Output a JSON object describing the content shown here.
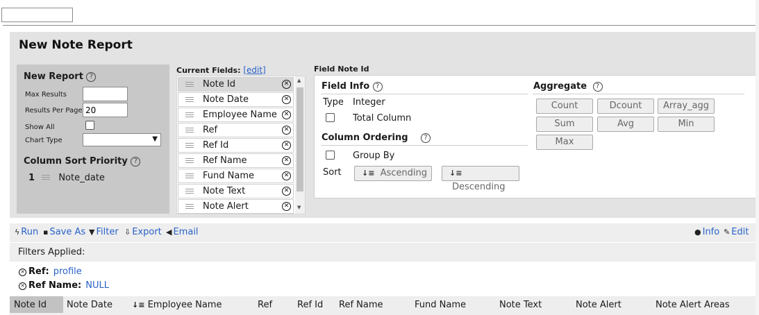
{
  "page": {
    "report_title": "New Note Report"
  },
  "new_report": {
    "heading": "New Report",
    "help": "?",
    "max_results_label": "Max Results",
    "max_results_value": "",
    "results_per_page_label": "Results Per Page",
    "results_per_page_value": "20",
    "show_all_label": "Show All",
    "chart_type_label": "Chart Type",
    "chart_type_value": ""
  },
  "column_sort": {
    "heading": "Column Sort Priority",
    "items": [
      {
        "index": "1",
        "label": "Note_date"
      }
    ]
  },
  "current_fields": {
    "label": "Current Fields:",
    "edit_link": "[edit]",
    "fields": [
      "Note Id",
      "Note Date",
      "Employee Name",
      "Ref",
      "Ref Id",
      "Ref Name",
      "Fund Name",
      "Note Text",
      "Note Alert"
    ],
    "selected": "Note Id"
  },
  "field_panel": {
    "title": "Field Note Id",
    "field_info_heading": "Field Info",
    "type_label": "Type",
    "type_value": "Integer",
    "total_column_label": "Total Column",
    "column_ordering_heading": "Column Ordering",
    "group_by_label": "Group By",
    "sort_label": "Sort",
    "ascending_label": "Ascending",
    "descending_label": "Descending",
    "aggregate_heading": "Aggregate",
    "aggregate_buttons": [
      "Count",
      "Dcount",
      "Array_agg",
      "Sum",
      "Avg",
      "Min",
      "Max"
    ]
  },
  "toolbar": {
    "run": "Run",
    "save_as": "Save As",
    "filter": "Filter",
    "export": "Export",
    "email": "Email",
    "info": "Info",
    "edit": "Edit"
  },
  "filters": {
    "heading": "Filters Applied:",
    "items": [
      {
        "name": "Ref:",
        "value": "profile"
      },
      {
        "name": "Ref Name:",
        "value": "NULL"
      }
    ]
  },
  "table": {
    "columns": [
      "Note Id",
      "Note Date",
      "Employee Name",
      "Ref",
      "Ref Id",
      "Ref Name",
      "Fund Name",
      "Note Text",
      "Note Alert",
      "Note Alert Areas"
    ]
  },
  "colors": {
    "link": "#2962c8",
    "panel_bg": "#e3e3e3",
    "left_box_bg": "#c8c8c8"
  }
}
